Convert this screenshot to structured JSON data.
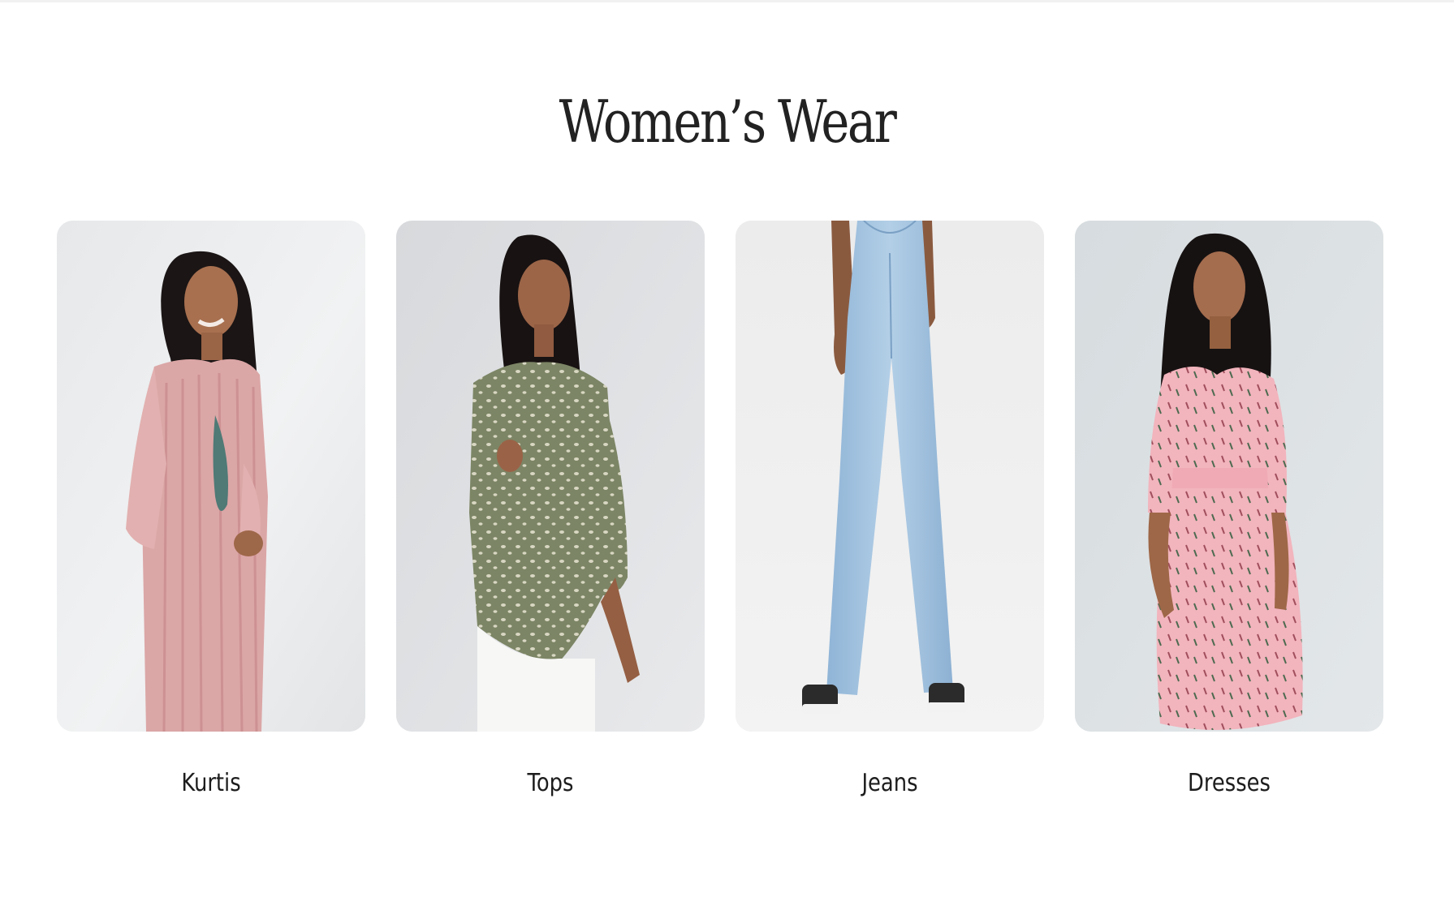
{
  "section": {
    "title": "Women’s Wear"
  },
  "categories": [
    {
      "label": "Kurtis",
      "image": "woman-in-pink-kurti"
    },
    {
      "label": "Tops",
      "image": "woman-in-olive-top"
    },
    {
      "label": "Jeans",
      "image": "light-blue-wide-leg-jeans"
    },
    {
      "label": "Dresses",
      "image": "woman-in-pink-dress"
    }
  ],
  "colors": {
    "background": "#ffffff",
    "text": "#222222",
    "card_background": "#e9ebed"
  }
}
